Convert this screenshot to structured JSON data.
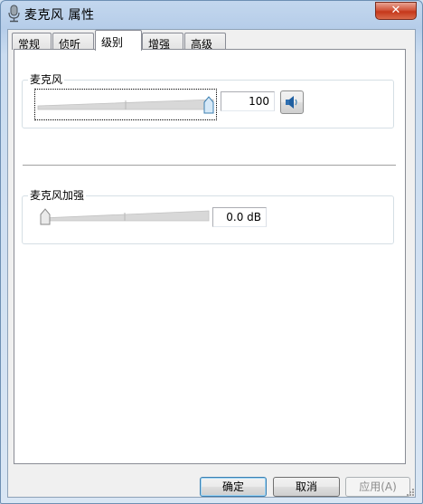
{
  "window": {
    "title": "麦克风 属性",
    "close_glyph": "✕",
    "icon": "microphone-icon"
  },
  "tabs": [
    {
      "label": "常规",
      "active": false
    },
    {
      "label": "侦听",
      "active": false
    },
    {
      "label": "级别",
      "active": true
    },
    {
      "label": "增强",
      "active": false
    },
    {
      "label": "高级",
      "active": false
    }
  ],
  "levels": {
    "microphone": {
      "label": "麦克风",
      "value": "100",
      "level_fraction": 1.0,
      "speaker_icon": "speaker-icon"
    },
    "boost": {
      "label": "麦克风加强",
      "value": "0.0 dB",
      "level_fraction": 0.0
    }
  },
  "buttons": {
    "ok": "确定",
    "cancel": "取消",
    "apply": "应用(A)"
  },
  "colors": {
    "title_bar": "#b9d1ea",
    "close_button": "#c5371b",
    "thumb_fill": "#d6e9f8",
    "track_fill": "#d8d8d8"
  }
}
